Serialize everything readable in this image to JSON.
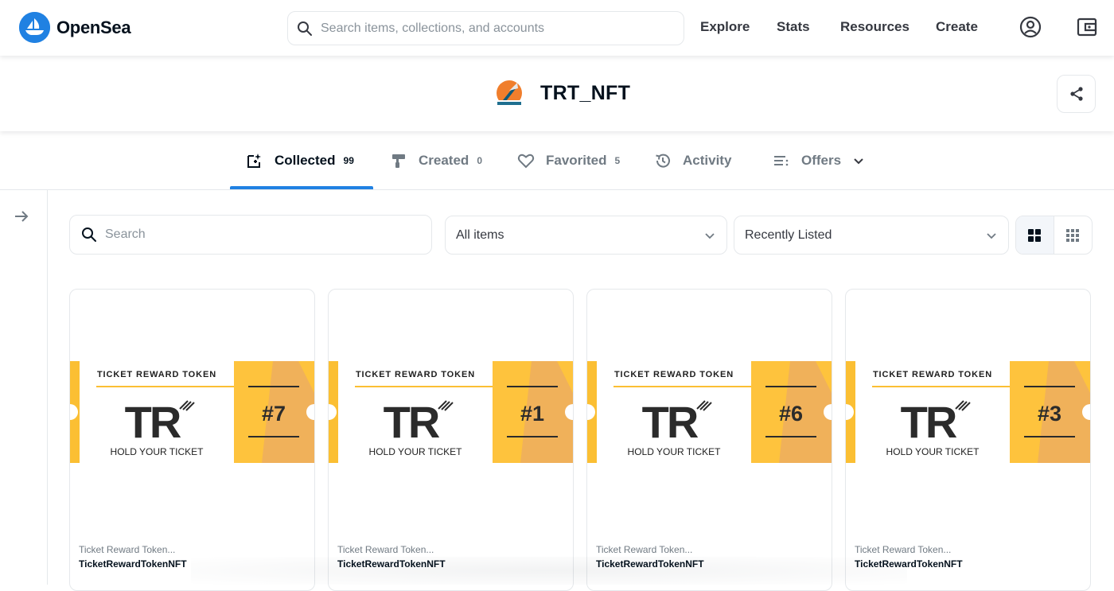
{
  "app": {
    "name": "OpenSea",
    "brand_color": "#2081e2"
  },
  "search": {
    "placeholder": "Search items, collections, and accounts"
  },
  "nav": {
    "links": [
      "Explore",
      "Stats",
      "Resources",
      "Create"
    ],
    "icons": [
      "account-icon",
      "wallet-icon"
    ]
  },
  "profile": {
    "name": "TRT_NFT"
  },
  "tabs": [
    {
      "label": "Collected",
      "count": "99",
      "active": true,
      "icon": "collected-icon"
    },
    {
      "label": "Created",
      "count": "0",
      "active": false,
      "icon": "paintbrush-icon"
    },
    {
      "label": "Favorited",
      "count": "5",
      "active": false,
      "icon": "heart-icon"
    },
    {
      "label": "Activity",
      "count": "",
      "active": false,
      "icon": "history-icon"
    },
    {
      "label": "Offers",
      "count": "",
      "active": false,
      "icon": "list-icon"
    }
  ],
  "filters": {
    "search_placeholder": "Search",
    "items_dropdown": "All items",
    "sort_dropdown": "Recently Listed",
    "view_mode": "large-grid"
  },
  "ticket": {
    "header": "TICKET REWARD TOKEN",
    "logo": "TR",
    "tagline": "HOLD YOUR TICKET",
    "stub_color": "#fec33d",
    "stub_shade": "#f0b15a",
    "stripe_color": "#fbbf33"
  },
  "cards": [
    {
      "number": "#7",
      "collection": "Ticket Reward Token...",
      "name": "TicketRewardTokenNFT"
    },
    {
      "number": "#1",
      "collection": "Ticket Reward Token...",
      "name": "TicketRewardTokenNFT"
    },
    {
      "number": "#6",
      "collection": "Ticket Reward Token...",
      "name": "TicketRewardTokenNFT"
    },
    {
      "number": "#3",
      "collection": "Ticket Reward Token...",
      "name": "TicketRewardTokenNFT"
    }
  ]
}
